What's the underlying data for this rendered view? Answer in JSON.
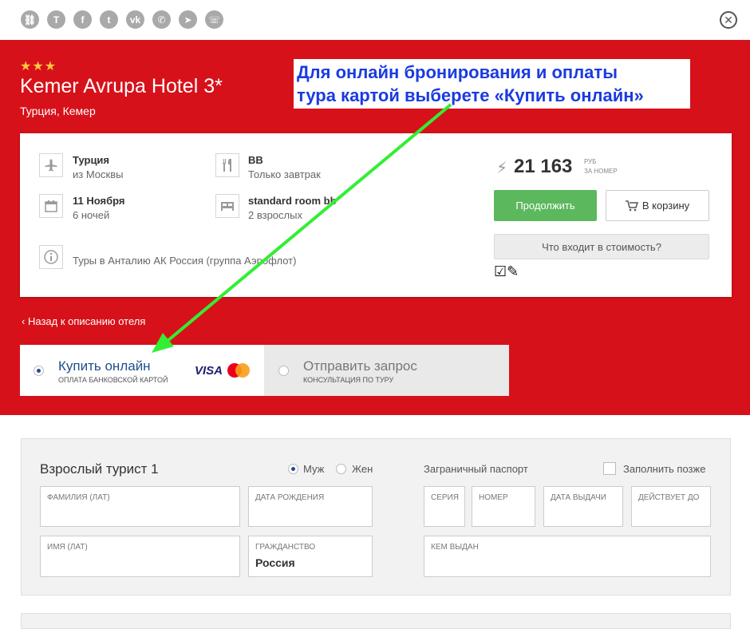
{
  "share_icons": [
    "link-icon",
    "tripadvisor-icon",
    "facebook-icon",
    "twitter-icon",
    "vk-icon",
    "whatsapp-icon",
    "telegram-icon",
    "viber-icon"
  ],
  "hotel": {
    "stars": "★★★",
    "name": "Kemer Avrupa Hotel 3*",
    "location": "Турция, Кемер"
  },
  "callout": {
    "line1": "Для онлайн бронирования и оплаты",
    "line2": "тура картой выберете «Купить онлайн»"
  },
  "tour": {
    "country": "Турция",
    "departure": "из Москвы",
    "meal_code": "BB",
    "meal": "Только завтрак",
    "date": "11 Ноября",
    "nights": "6 ночей",
    "room": "standard room bb",
    "guests": "2 взрослых",
    "operator": "Туры в Анталию АК Россия (группа Аэрофлот)"
  },
  "price": {
    "amount": "21 163",
    "currency": "РУБ",
    "per": "ЗА НОМЕР"
  },
  "buttons": {
    "continue": "Продолжить",
    "cart": "В корзину",
    "included": "Что входит в стоимость?"
  },
  "back_link": "Назад к описанию отеля",
  "payment": {
    "online_title": "Купить онлайн",
    "online_sub": "ОПЛАТА БАНКОВСКОЙ КАРТОЙ",
    "visa": "VISA",
    "mastercard": "MasterCard",
    "request_title": "Отправить запрос",
    "request_sub": "КОНСУЛЬТАЦИЯ ПО ТУРУ"
  },
  "tourist_form": {
    "title": "Взрослый турист 1",
    "gender_male": "Муж",
    "gender_female": "Жен",
    "passport_title": "Заграничный паспорт",
    "fill_later": "Заполнить позже",
    "surname_label": "ФАМИЛИЯ (ЛАТ)",
    "birth_label": "ДАТА РОЖДЕНИЯ",
    "series_label": "СЕРИЯ",
    "number_label": "НОМЕР",
    "issue_date_label": "ДАТА ВЫДАЧИ",
    "valid_label": "ДЕЙСТВУЕТ ДО",
    "name_label": "ИМЯ (ЛАТ)",
    "citizenship_label": "ГРАЖДАНСТВО",
    "citizenship_value": "Россия",
    "issued_by_label": "КЕМ ВЫДАН"
  },
  "colors": {
    "brand_red": "#d7111a",
    "green": "#5cb85c",
    "callout_blue": "#1b3be0",
    "arrow_green": "#33ee33"
  }
}
